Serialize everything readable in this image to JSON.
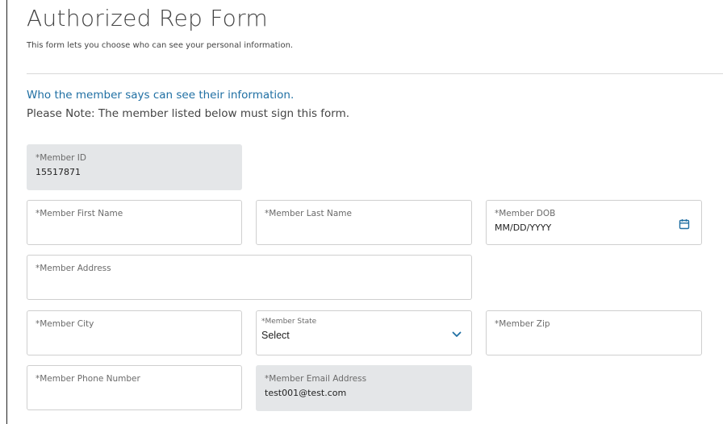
{
  "page": {
    "title": "Authorized Rep Form",
    "subtitle": "This form lets you choose who can see your personal information."
  },
  "section": {
    "heading": "Who the member says can see their information.",
    "note": "Please Note: The member listed below must sign this form."
  },
  "fields": {
    "member_id": {
      "label": "*Member ID",
      "value": "15517871"
    },
    "first_name": {
      "label": "*Member First Name",
      "value": ""
    },
    "last_name": {
      "label": "*Member Last Name",
      "value": ""
    },
    "dob": {
      "label": "*Member DOB",
      "placeholder": "MM/DD/YYYY"
    },
    "address": {
      "label": "*Member Address",
      "value": ""
    },
    "city": {
      "label": "*Member City",
      "value": ""
    },
    "state": {
      "label": "*Member State",
      "selected": "Select"
    },
    "zip": {
      "label": "*Member Zip",
      "value": ""
    },
    "phone": {
      "label": "*Member Phone Number",
      "value": ""
    },
    "email": {
      "label": "*Member Email Address",
      "value": "test001@test.com"
    }
  },
  "colors": {
    "accent": "#1f6fa3",
    "readonly_bg": "#e4e6e8",
    "border": "#cfcfcf"
  },
  "icons": {
    "dob": "calendar-icon",
    "state": "chevron-down-icon"
  }
}
